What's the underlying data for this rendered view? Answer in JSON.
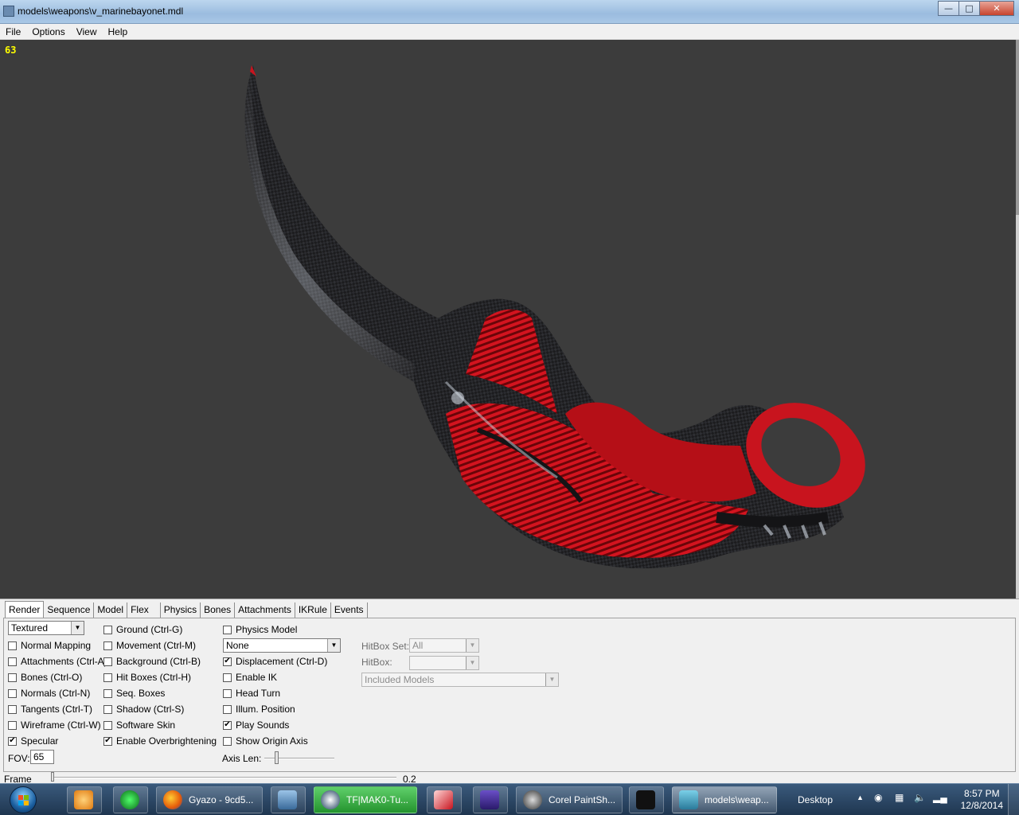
{
  "window": {
    "title": "models\\weapons\\v_marinebayonet.mdl"
  },
  "menu": [
    "File",
    "Options",
    "View",
    "Help"
  ],
  "viewport": {
    "fps": "63"
  },
  "tabs": [
    "Render",
    "Sequence",
    "Model",
    "Flex",
    "Physics",
    "Bones",
    "Attachments",
    "IKRule",
    "Events"
  ],
  "render": {
    "mode": "Textured",
    "col1": [
      {
        "label": "Normal Mapping",
        "checked": false
      },
      {
        "label": "Attachments (Ctrl-A)",
        "checked": false
      },
      {
        "label": "Bones (Ctrl-O)",
        "checked": false
      },
      {
        "label": "Normals (Ctrl-N)",
        "checked": false
      },
      {
        "label": "Tangents (Ctrl-T)",
        "checked": false
      },
      {
        "label": "Wireframe (Ctrl-W)",
        "checked": false
      },
      {
        "label": "Specular",
        "checked": true
      }
    ],
    "col2": [
      {
        "label": "Ground (Ctrl-G)",
        "checked": false
      },
      {
        "label": "Movement (Ctrl-M)",
        "checked": false
      },
      {
        "label": "Background (Ctrl-B)",
        "checked": false
      },
      {
        "label": "Hit Boxes (Ctrl-H)",
        "checked": false
      },
      {
        "label": "Seq. Boxes",
        "checked": false
      },
      {
        "label": "Shadow (Ctrl-S)",
        "checked": false
      },
      {
        "label": "Software Skin",
        "checked": false
      },
      {
        "label": "Enable Overbrightening",
        "checked": true
      }
    ],
    "physics_model_label": "Physics Model",
    "physics_select": "None",
    "col3": [
      {
        "label": "Displacement (Ctrl-D)",
        "checked": true
      },
      {
        "label": "Enable IK",
        "checked": false
      },
      {
        "label": "Head Turn",
        "checked": false
      },
      {
        "label": "Illum. Position",
        "checked": false
      },
      {
        "label": "Play Sounds",
        "checked": true
      },
      {
        "label": "Show Origin Axis",
        "checked": false
      }
    ],
    "fov_label": "FOV:",
    "fov_value": "65",
    "axis_len_label": "Axis Len:",
    "hitbox_set_label": "HitBox Set:",
    "hitbox_set_value": "All",
    "hitbox_label": "HitBox:",
    "hitbox_value": "",
    "included_models": "Included Models"
  },
  "frame": {
    "label": "Frame",
    "value": "0.2"
  },
  "taskbar": {
    "items": [
      {
        "label": "Gyazo - 9cd5..."
      },
      {
        "label": "TF|MAK0-Tu..."
      },
      {
        "label": "Corel PaintSh..."
      },
      {
        "label": "models\\weap..."
      }
    ],
    "desktop": "Desktop",
    "time": "8:57 PM",
    "date": "12/8/2014"
  },
  "colors": {
    "fps": "#ffff00",
    "viewport_bg": "#3c3c3c",
    "knife_red": "#c8141e"
  }
}
